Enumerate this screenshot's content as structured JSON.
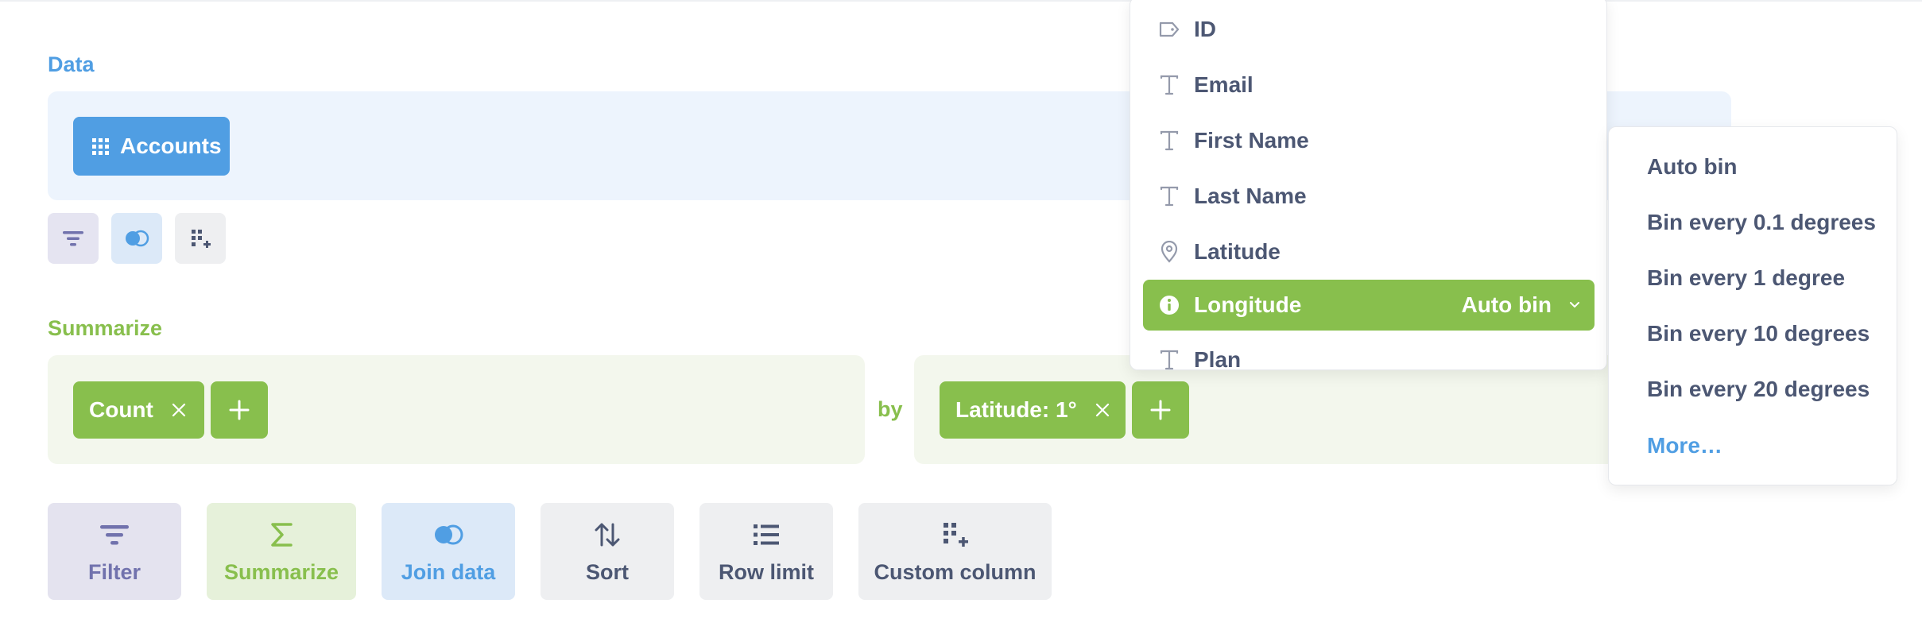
{
  "data_section": {
    "label": "Data",
    "table_name": "Accounts"
  },
  "summarize_section": {
    "label": "Summarize",
    "metric": "Count",
    "by_label": "by",
    "breakout": "Latitude: 1°"
  },
  "actions": {
    "filter": "Filter",
    "summarize": "Summarize",
    "join": "Join data",
    "sort": "Sort",
    "row_limit": "Row limit",
    "custom_column": "Custom column"
  },
  "column_picker": {
    "items": [
      {
        "label": "ID",
        "icon": "tag-icon"
      },
      {
        "label": "Email",
        "icon": "text-icon"
      },
      {
        "label": "First Name",
        "icon": "text-icon"
      },
      {
        "label": "Last Name",
        "icon": "text-icon"
      },
      {
        "label": "Latitude",
        "icon": "location-pin-icon"
      },
      {
        "label": "Longitude",
        "icon": "info-icon",
        "selected": true,
        "binning": "Auto bin"
      },
      {
        "label": "Plan",
        "icon": "text-icon"
      }
    ]
  },
  "binning_menu": {
    "options": [
      "Auto bin",
      "Bin every 0.1 degrees",
      "Bin every 1 degree",
      "Bin every 10 degrees",
      "Bin every 20 degrees"
    ],
    "more": "More…"
  },
  "colors": {
    "brand_blue": "#509ee3",
    "summarize_green": "#88bf4d",
    "filter_purple": "#7172ad",
    "text_dark": "#4c5773"
  }
}
